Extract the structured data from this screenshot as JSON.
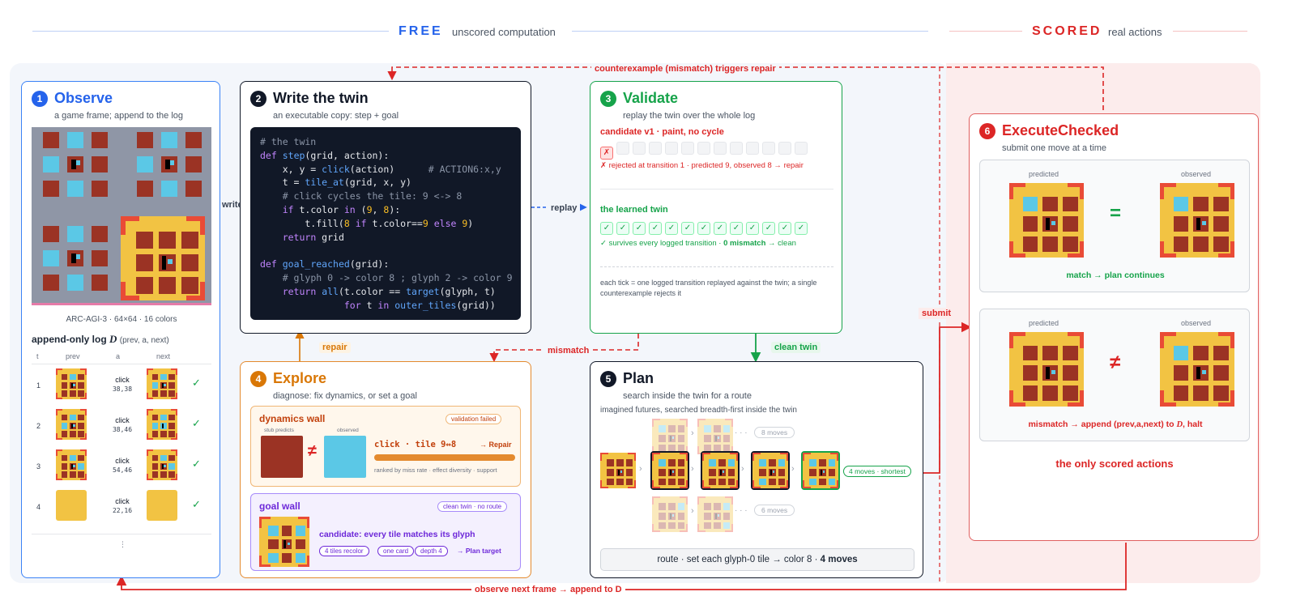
{
  "header": {
    "free_label": "FREE",
    "free_sub": "unscored computation",
    "scored_label": "SCORED",
    "scored_sub": "real actions"
  },
  "colors": {
    "blue": "#2563eb",
    "dark": "#111827",
    "green": "#16a34a",
    "orange": "#d97706",
    "purple": "#7c3aed",
    "red": "#dc2626",
    "tile_red": "#9b3324",
    "tile_cyan": "#5bc8e6",
    "frame_yellow": "#f2c343",
    "frame_corner": "#e94b36",
    "frame_bg": "#8f96a6"
  },
  "arrows": {
    "counterexample": "counterexample (mismatch) triggers repair",
    "write": "write",
    "replay": "replay",
    "repair": "repair",
    "mismatch": "mismatch",
    "clean_twin": "clean twin",
    "submit": "submit",
    "observe_next": "observe next frame → append to D"
  },
  "observe": {
    "num": "1",
    "title": "Observe",
    "subtitle": "a game frame; append to the log",
    "caption": "ARC-AGI-3 · 64×64 · 16 colors",
    "log_title": "append-only log",
    "log_symbol": "D",
    "log_args": "(prev, a, next)",
    "cols": [
      "t",
      "prev",
      "a",
      "next"
    ],
    "rows": [
      {
        "t": "1",
        "action": "click",
        "coord": "38,38",
        "check": "✓"
      },
      {
        "t": "2",
        "action": "click",
        "coord": "38,46",
        "check": "✓"
      },
      {
        "t": "3",
        "action": "click",
        "coord": "54,46",
        "check": "✓"
      },
      {
        "t": "4",
        "action": "click",
        "coord": "22,16",
        "check": "✓"
      }
    ],
    "more": "⋮"
  },
  "twin": {
    "num": "2",
    "title": "Write the twin",
    "subtitle": "an executable copy: step + goal",
    "code": [
      "# the twin",
      "def step(grid, action):",
      "    x, y = click(action)      # ACTION6:x,y",
      "    t = tile_at(grid, x, y)",
      "    # click cycles the tile: 9 <-> 8",
      "    if t.color in (9, 8):",
      "        t.fill(8 if t.color==9 else 9)",
      "    return grid",
      "",
      "def goal_reached(grid):",
      "    # glyph 0 -> color 8 ; glyph 2 -> color 9",
      "    return all(t.color == target(glyph, t)",
      "               for t in outer_tiles(grid))"
    ]
  },
  "validate": {
    "num": "3",
    "title": "Validate",
    "subtitle": "replay the twin over the whole log",
    "cand_title": "candidate v1 · paint, no cycle",
    "cand_fail_mark": "✗",
    "cand_note": "✗ rejected at transition 1 · predicted 9, observed 8  → repair",
    "learned_title": "the learned twin",
    "learned_note_a": "✓ survives every logged transition · ",
    "learned_note_b": "0 mismatch",
    "learned_note_c": " → clean",
    "tick_char": "✓",
    "footnote": "each tick = one logged transition replayed against the twin; a single counterexample rejects it"
  },
  "explore": {
    "num": "4",
    "title": "Explore",
    "subtitle": "diagnose: fix dynamics, or set a goal",
    "dyn_title": "dynamics wall",
    "dyn_pill": "validation failed",
    "stub_label": "stub predicts",
    "obs_label": "observed",
    "neq": "≠",
    "dyn_action": "click · tile 9↔8",
    "dyn_repair": "→ Repair",
    "dyn_rank": "ranked by miss rate · effect diversity · support",
    "dyn_progress": 1.0,
    "goal_title": "goal wall",
    "goal_pill": "clean twin · no route",
    "goal_cand": "candidate: every tile matches its glyph",
    "goal_tags": [
      "4 tiles recolor",
      "one card",
      "depth 4"
    ],
    "goal_target": "→ Plan target"
  },
  "plan": {
    "num": "5",
    "title": "Plan",
    "subtitle": "search inside the twin for a route",
    "sub2": "imagined futures, searched breadth-first inside the twin",
    "alt_top": "8 moves",
    "alt_bottom": "6 moves",
    "ellipsis": "· · ·",
    "best": "4 moves · shortest",
    "route_a": "route · set each glyph-0 tile → color 8 · ",
    "route_b": "4 moves"
  },
  "execute": {
    "num": "6",
    "title": "ExecuteChecked",
    "subtitle": "submit one move at a time",
    "predicted": "predicted",
    "observed": "observed",
    "eq": "=",
    "neq": "≠",
    "match_note": "match → plan continues",
    "mismatch_a": "mismatch → append (prev,a,next) to ",
    "mismatch_b": "D",
    "mismatch_c": ", halt",
    "only_scored": "the only scored actions"
  }
}
